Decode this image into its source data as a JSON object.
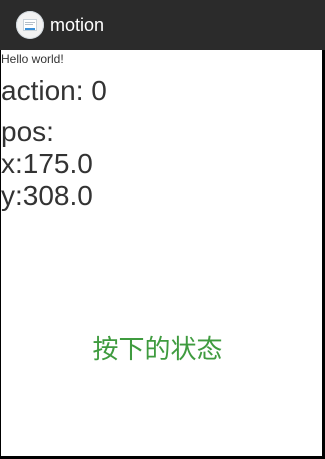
{
  "app": {
    "title": "motion",
    "icon": "app-notes-icon"
  },
  "content": {
    "hello_text": "Hello world!",
    "action_label": "action: 0",
    "pos_label": "pos:",
    "pos_x": "x:175.0",
    "pos_y": "y:308.0",
    "press_state": "按下的状态"
  },
  "colors": {
    "action_bar": "#2b2b2b",
    "background": "#ffffff",
    "text_dark": "#333333",
    "accent_green": "#3f9b3f"
  }
}
